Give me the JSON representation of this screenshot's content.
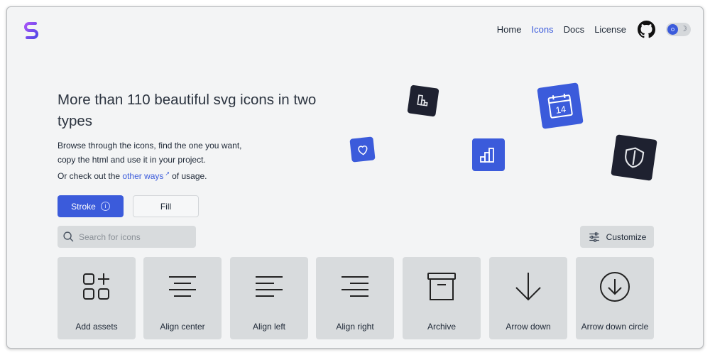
{
  "nav": {
    "items": [
      {
        "label": "Home",
        "active": false
      },
      {
        "label": "Icons",
        "active": true
      },
      {
        "label": "Docs",
        "active": false
      },
      {
        "label": "License",
        "active": false
      }
    ]
  },
  "hero": {
    "title": "More than 110 beautiful svg icons in two types",
    "desc_line1": "Browse through the icons, find the one you want,",
    "desc_line2": "copy the html and use it in your project.",
    "desc_line3_prefix": "Or check out the",
    "desc_link": "other ways",
    "desc_line3_suffix": "of usage.",
    "calendar_day": "14"
  },
  "types": {
    "stroke_label": "Stroke",
    "fill_label": "Fill"
  },
  "search": {
    "placeholder": "Search for icons"
  },
  "customize_label": "Customize",
  "icons": [
    {
      "label": "Add assets",
      "icon": "add-assets"
    },
    {
      "label": "Align center",
      "icon": "align-center"
    },
    {
      "label": "Align left",
      "icon": "align-left"
    },
    {
      "label": "Align right",
      "icon": "align-right"
    },
    {
      "label": "Archive",
      "icon": "archive"
    },
    {
      "label": "Arrow down",
      "icon": "arrow-down"
    },
    {
      "label": "Arrow down circle",
      "icon": "arrow-down-circle"
    }
  ],
  "colors": {
    "accent": "#3b5bdb",
    "dark_tile": "#1e2130",
    "card_bg": "#d8dbdd",
    "page_bg": "#f3f4f5"
  }
}
